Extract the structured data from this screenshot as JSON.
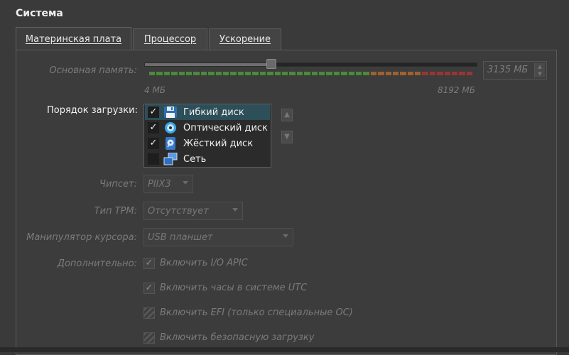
{
  "section": {
    "title": "Система"
  },
  "tabs": [
    {
      "label": "Материнская плата",
      "active": true
    },
    {
      "label": "Процессор",
      "active": false
    },
    {
      "label": "Ускорение",
      "active": false
    }
  ],
  "memory": {
    "label": "Основная память:",
    "min_label": "4 МБ",
    "max_label": "8192 МБ",
    "value_text": "3135 МБ",
    "value_mb": 3135,
    "min_mb": 4,
    "max_mb": 8192
  },
  "boot_order": {
    "label": "Порядок загрузки:",
    "items": [
      {
        "label": "Гибкий диск",
        "checked": true,
        "selected": true,
        "icon": "floppy-icon"
      },
      {
        "label": "Оптический диск",
        "checked": true,
        "selected": false,
        "icon": "optical-disc-icon"
      },
      {
        "label": "Жёсткий диск",
        "checked": true,
        "selected": false,
        "icon": "hard-disk-icon"
      },
      {
        "label": "Сеть",
        "checked": false,
        "selected": false,
        "icon": "network-icon"
      }
    ]
  },
  "chipset": {
    "label": "Чипсет:",
    "value": "PIIX3"
  },
  "tpm": {
    "label": "Тип TPM:",
    "value": "Отсутствует"
  },
  "pointer": {
    "label": "Манипулятор курсора:",
    "value": "USB планшет"
  },
  "extended": {
    "label": "Дополнительно:",
    "options": [
      {
        "label": "Включить I/O APIC",
        "checked": true
      },
      {
        "label": "Включить часы в системе UTC",
        "checked": true
      },
      {
        "label": "Включить EFI (только специальные ОС)",
        "checked": false
      },
      {
        "label": "Включить безопасную загрузку",
        "checked": false
      }
    ]
  },
  "colors": {
    "scale_green": "#4a8a3a",
    "scale_orange": "#a0602e",
    "scale_red": "#9a3434",
    "selection": "#2d4f59"
  }
}
